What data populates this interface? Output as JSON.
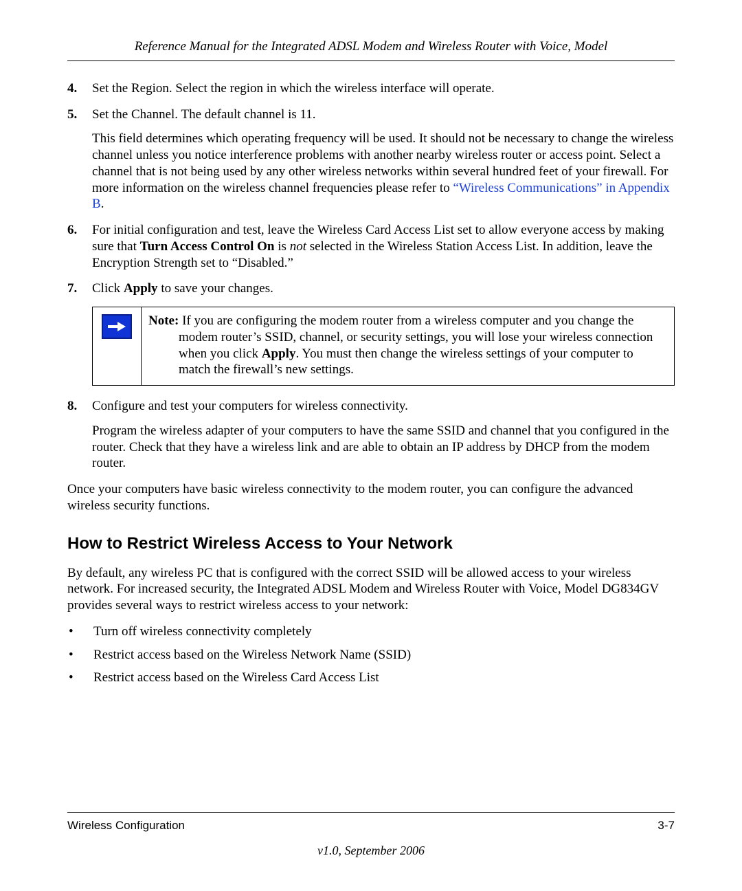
{
  "header": {
    "running_head": "Reference Manual for the Integrated ADSL Modem and Wireless Router with Voice, Model"
  },
  "list": {
    "items": [
      {
        "num": "4.",
        "text": "Set the Region. Select the region in which the wireless interface will operate."
      },
      {
        "num": "5.",
        "text": "Set the Channel. The default channel is 11.",
        "para2_pre": "This field determines which operating frequency will be used. It should not be necessary to change the wireless channel unless you notice interference problems with another nearby wireless router or access point. Select a channel that is not being used by any other wireless networks within several hundred feet of your firewall. For more information on the wireless channel frequencies please refer to ",
        "para2_link": "“Wireless Communications” in Appendix B",
        "para2_post": "."
      },
      {
        "num": "6.",
        "pre1": "For initial configuration and test, leave the Wireless Card Access List set to allow everyone access by making sure that ",
        "bold1": "Turn Access Control On",
        "mid1": " is ",
        "ital1": "not",
        "post1": " selected in the Wireless Station Access List. In addition, leave the Encryption Strength set to “Disabled.”"
      },
      {
        "num": "7.",
        "pre": "Click ",
        "bold": "Apply",
        "post": " to save your changes."
      },
      {
        "num": "8.",
        "text": "Configure and test your computers for wireless connectivity.",
        "para2": "Program the wireless adapter of your computers to have the same SSID and channel that you configured in the router. Check that they have a wireless link and are able to obtain an IP address by DHCP from the modem router."
      }
    ]
  },
  "note": {
    "label": "Note:",
    "pre": " If you are configuring the modem router from a wireless computer and you change the modem router’s SSID, channel, or security settings, you will lose your wireless connection when you click ",
    "bold": "Apply",
    "post": ". You must then change the wireless settings of your computer to match the firewall’s new settings."
  },
  "after_list": "Once your computers have basic wireless connectivity to the modem router, you can configure the advanced wireless security functions.",
  "section": {
    "heading": "How to Restrict Wireless Access to Your Network",
    "intro": "By default, any wireless PC that is configured with the correct SSID will be allowed access to your wireless network. For increased security, the Integrated ADSL Modem and Wireless Router with Voice, Model DG834GV provides several ways to restrict wireless access to your network:",
    "bullets": [
      "Turn off wireless connectivity completely",
      "Restrict access based on the Wireless Network Name (SSID)",
      "Restrict access based on the Wireless Card Access List"
    ]
  },
  "footer": {
    "left": "Wireless Configuration",
    "right": "3-7",
    "version": "v1.0, September 2006"
  }
}
